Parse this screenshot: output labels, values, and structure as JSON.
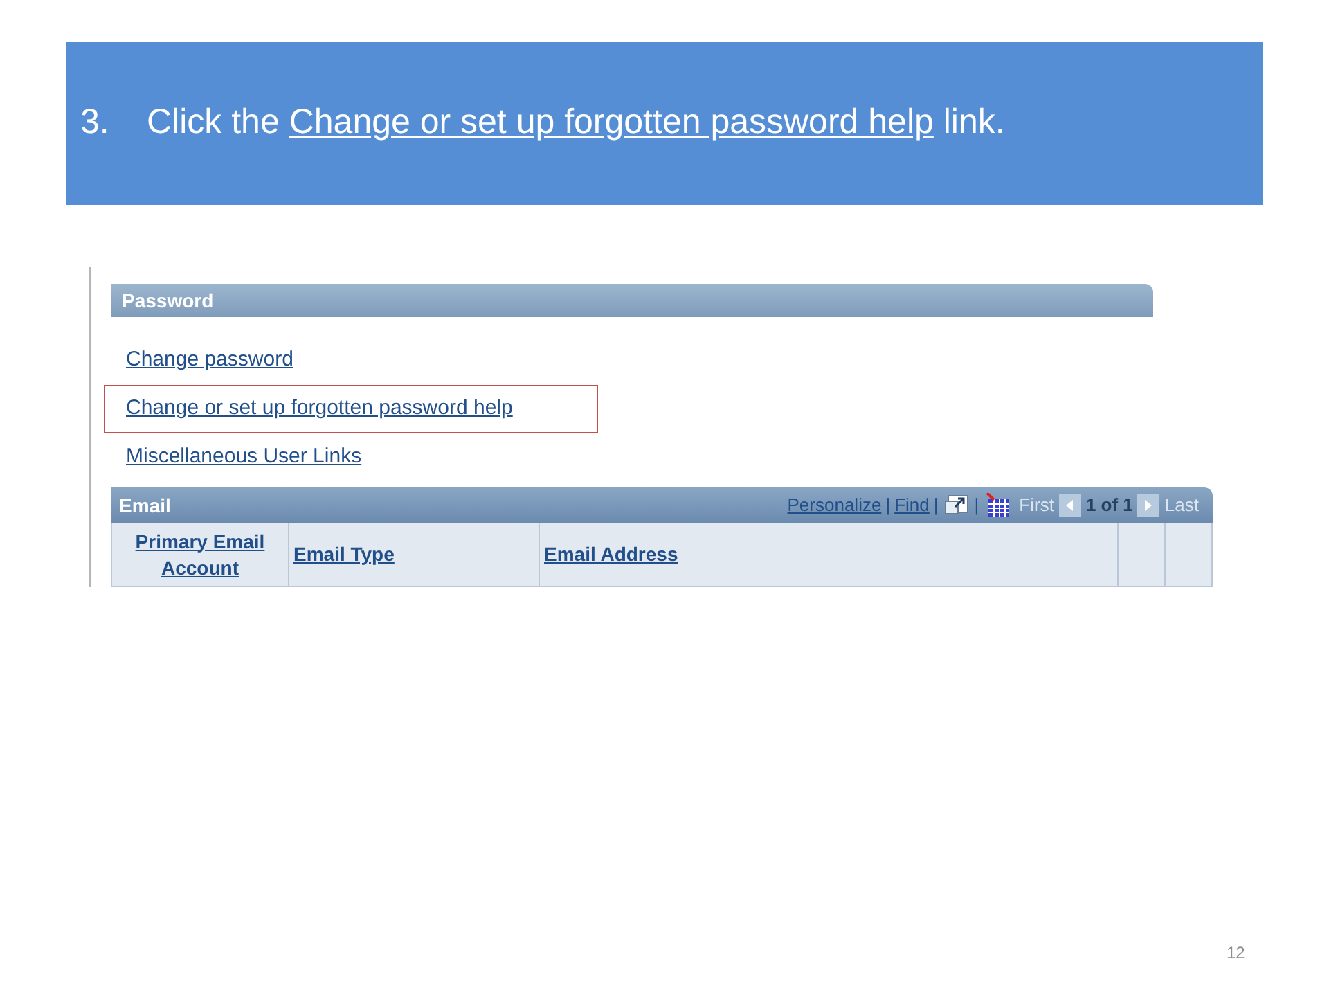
{
  "step": {
    "number": "3.",
    "before": "Click the",
    "link": "Change or set up forgotten password help",
    "after": "link."
  },
  "password_section": {
    "title": "Password",
    "links": [
      {
        "label": "Change password",
        "highlighted": false
      },
      {
        "label": "Change or set up forgotten password help",
        "highlighted": true
      },
      {
        "label": "Miscellaneous User Links",
        "highlighted": false
      }
    ]
  },
  "email_grid": {
    "title": "Email",
    "toolbar": [
      {
        "kind": "link",
        "text": "Personalize"
      },
      {
        "kind": "separator",
        "text": "|"
      },
      {
        "kind": "link",
        "text": "Find"
      },
      {
        "kind": "separator",
        "text": "|"
      },
      {
        "kind": "view-all-icon"
      },
      {
        "kind": "separator",
        "text": "|"
      },
      {
        "kind": "grid-icon"
      },
      {
        "kind": "disabled",
        "text": "First"
      },
      {
        "kind": "prev-icon"
      },
      {
        "kind": "counter",
        "text": "1 of 1"
      },
      {
        "kind": "next-icon"
      },
      {
        "kind": "disabled",
        "text": "Last"
      }
    ],
    "columns": [
      "Primary Email Account",
      "Email Type",
      "Email Address"
    ]
  },
  "page_number": "12"
}
